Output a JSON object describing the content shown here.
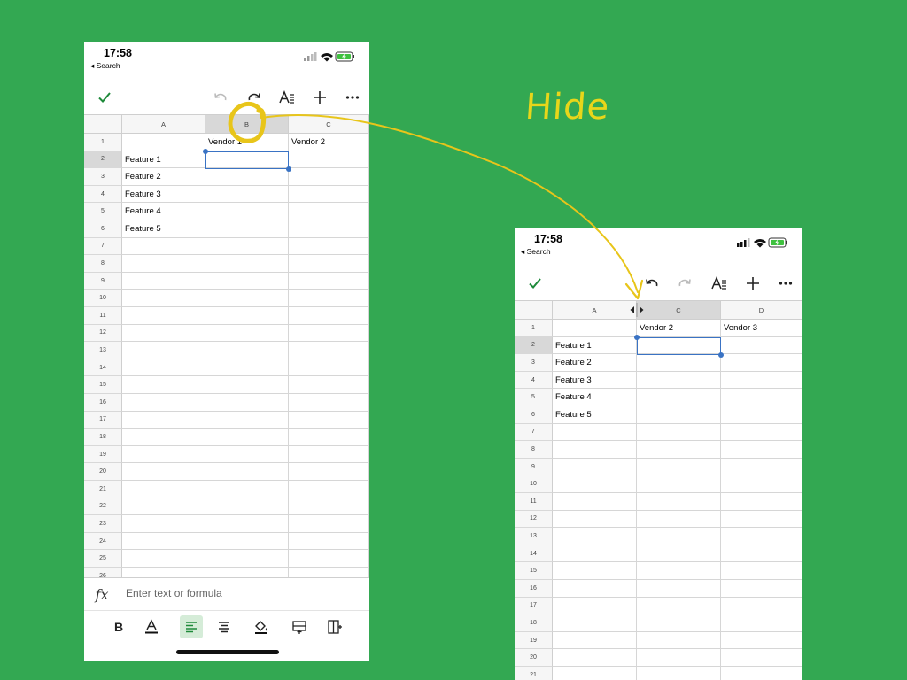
{
  "annotation": {
    "label": "Hide",
    "color": "#e8c51a"
  },
  "accent": "#3a73c4",
  "brand_green": "#33a852",
  "before": {
    "status": {
      "time": "17:58",
      "back": "◂ Search"
    },
    "formula_placeholder": "Enter text or formula",
    "columns": [
      "A",
      "B",
      "C"
    ],
    "selected_column": "B",
    "rows": [
      "1",
      "2",
      "3",
      "4",
      "5",
      "6",
      "7",
      "8",
      "9",
      "10",
      "11",
      "12",
      "13",
      "14",
      "15",
      "16",
      "17",
      "18",
      "19",
      "20",
      "21",
      "22",
      "23",
      "24",
      "25",
      "26"
    ],
    "cells": [
      [
        "",
        "Vendor 1",
        "Vendor 2"
      ],
      [
        "Feature 1",
        "",
        ""
      ],
      [
        "Feature 2",
        "",
        ""
      ],
      [
        "Feature 3",
        "",
        ""
      ],
      [
        "Feature 4",
        "",
        ""
      ],
      [
        "Feature 5",
        "",
        ""
      ]
    ]
  },
  "after": {
    "status": {
      "time": "17:58",
      "back": "◂ Search"
    },
    "columns": [
      "A",
      "C",
      "D"
    ],
    "rows": [
      "1",
      "2",
      "3",
      "4",
      "5",
      "6",
      "7",
      "8",
      "9",
      "10",
      "11",
      "12",
      "13",
      "14",
      "15",
      "16",
      "17",
      "18",
      "19",
      "20",
      "21"
    ],
    "cells": [
      [
        "",
        "Vendor 2",
        "Vendor 3"
      ],
      [
        "Feature 1",
        "",
        ""
      ],
      [
        "Feature 2",
        "",
        ""
      ],
      [
        "Feature 3",
        "",
        ""
      ],
      [
        "Feature 4",
        "",
        ""
      ],
      [
        "Feature 5",
        "",
        ""
      ]
    ]
  }
}
